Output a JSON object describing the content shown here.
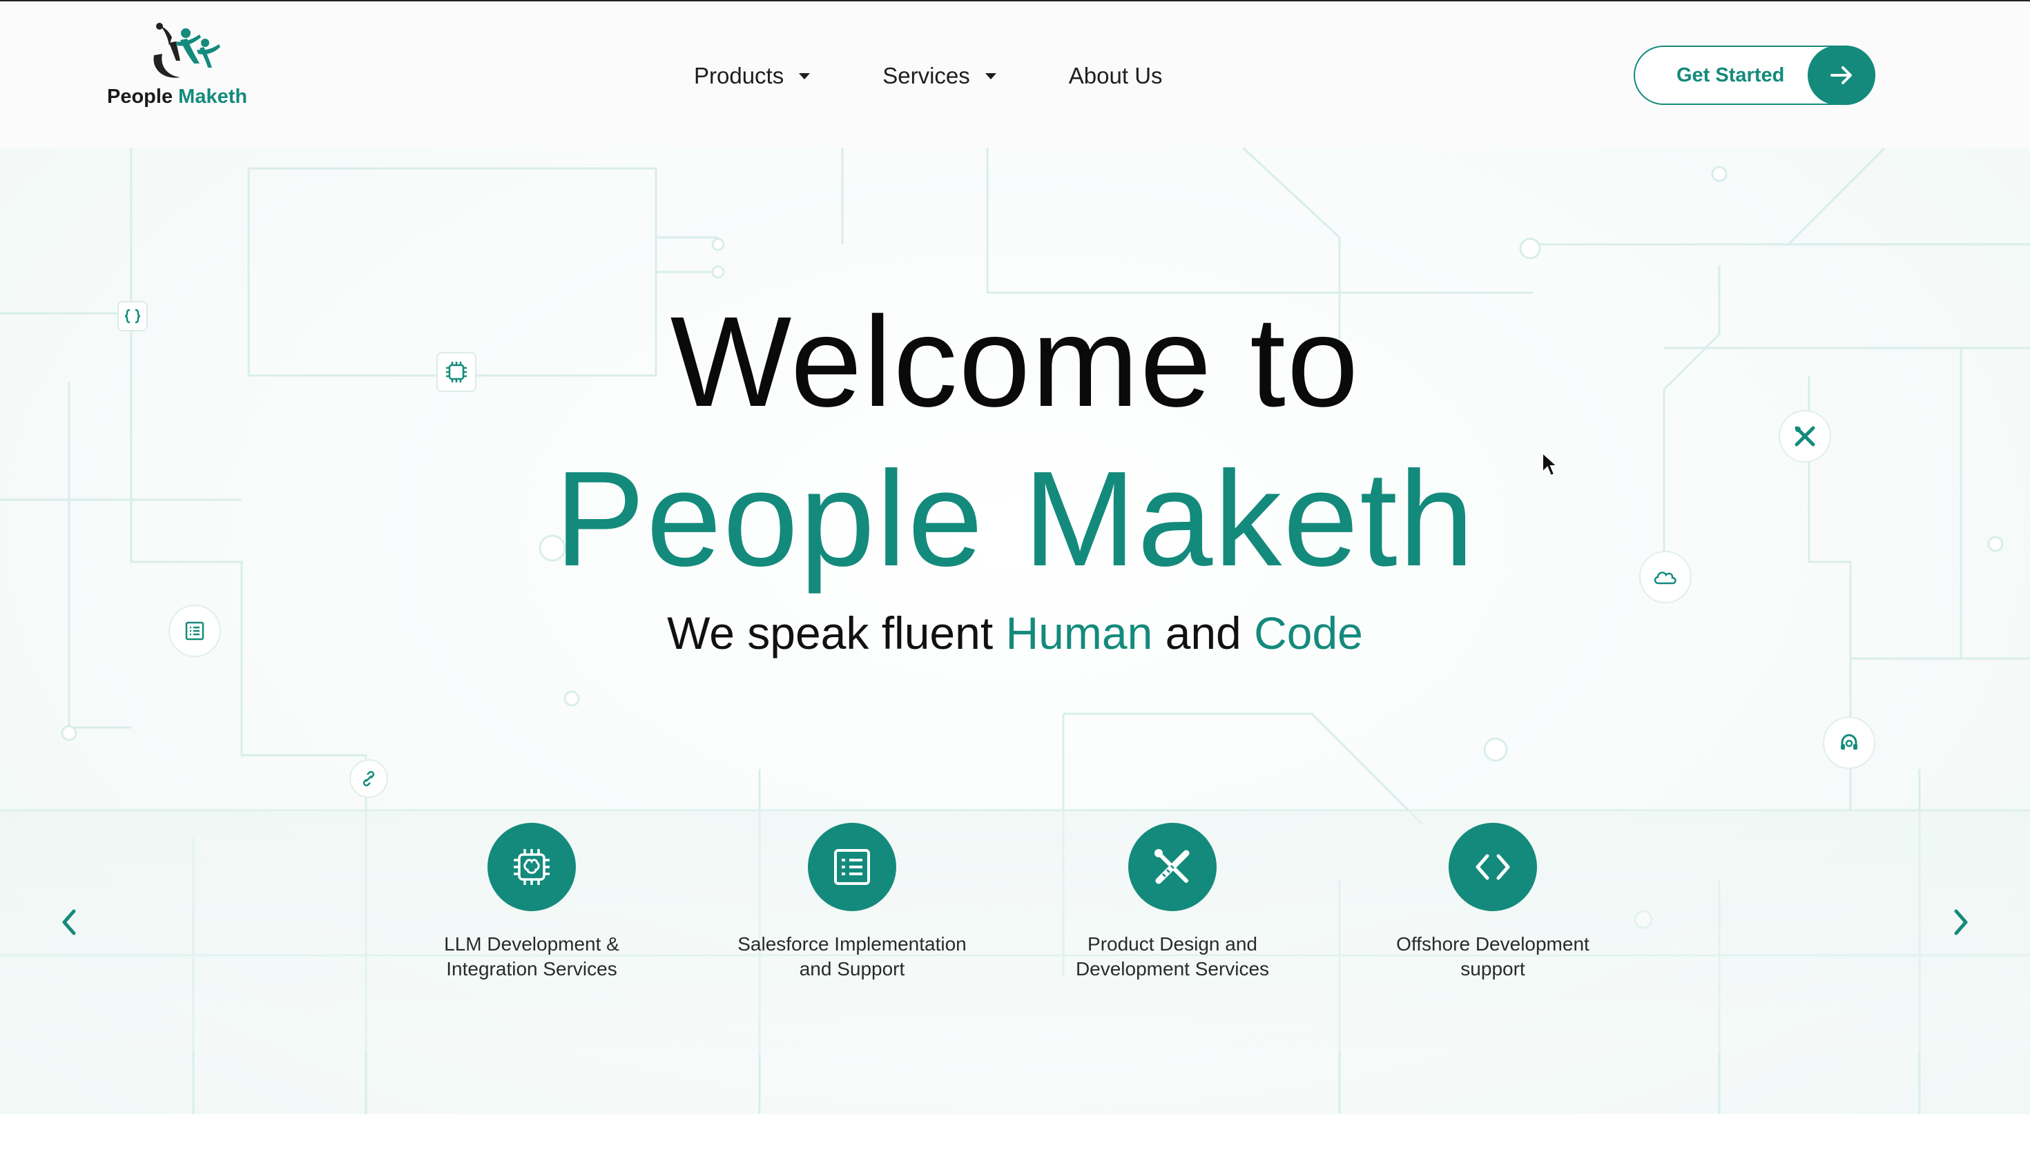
{
  "brand": {
    "name_part1": "People",
    "name_part2": "Maketh",
    "accent_color": "#138a7c"
  },
  "nav": {
    "items": [
      {
        "label": "Products",
        "has_dropdown": true
      },
      {
        "label": "Services",
        "has_dropdown": true
      },
      {
        "label": "About Us",
        "has_dropdown": false
      }
    ]
  },
  "cta": {
    "label": "Get Started",
    "icon": "arrow-right-icon"
  },
  "hero": {
    "title_line1": "Welcome to",
    "title_line2": "People Maketh",
    "tagline": {
      "prefix": "We speak fluent",
      "word1": "Human",
      "middle": "and",
      "word2": "Code"
    },
    "floating_icons": [
      "code-braces-icon",
      "chip-icon",
      "list-icon",
      "link-icon",
      "tools-icon",
      "cloud-icon",
      "headset-icon"
    ]
  },
  "services": {
    "items": [
      {
        "label_line1": "LLM Development &",
        "label_line2": "Integration Services",
        "icon": "ai-chip-icon"
      },
      {
        "label_line1": "Salesforce Implementation",
        "label_line2": "and Support",
        "icon": "list-icon"
      },
      {
        "label_line1": "Product Design and",
        "label_line2": "Development Services",
        "icon": "design-tools-icon"
      },
      {
        "label_line1": "Offshore Development",
        "label_line2": "support",
        "icon": "code-icon"
      }
    ],
    "prev_icon": "chevron-left-icon",
    "next_icon": "chevron-right-icon"
  }
}
